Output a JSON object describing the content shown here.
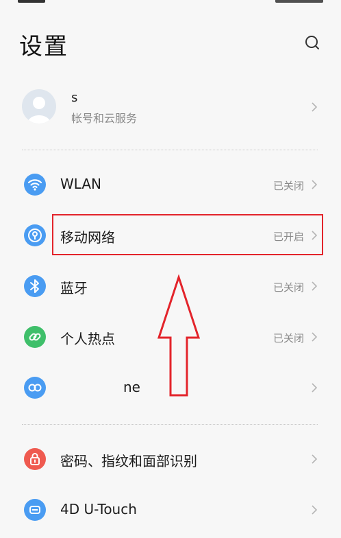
{
  "header": {
    "title": "设置"
  },
  "account": {
    "name": "s",
    "subtitle": "帐号和云服务"
  },
  "settings": [
    {
      "label": "WLAN",
      "value": "已关闭",
      "icon": "wifi-icon",
      "color": "#4a9cf2"
    },
    {
      "label": "移动网络",
      "value": "已开启",
      "icon": "mobile-network-icon",
      "color": "#4a9cf2"
    },
    {
      "label": "蓝牙",
      "value": "已关闭",
      "icon": "bluetooth-icon",
      "color": "#4a9cf2"
    },
    {
      "label": "个人热点",
      "value": "已关闭",
      "icon": "hotspot-icon",
      "color": "#3fbf6a"
    },
    {
      "label": "ne",
      "value": "",
      "icon": "link-icon",
      "color": "#4a9cf2"
    },
    {
      "label": "密码、指纹和面部识别",
      "value": "",
      "icon": "lock-icon",
      "color": "#ef5a50"
    },
    {
      "label": "4D U-Touch",
      "value": "",
      "icon": "touch-icon",
      "color": "#4a9cf2"
    }
  ],
  "annotation": {
    "box_color": "#e3242b",
    "arrow_color": "#e3242b"
  }
}
